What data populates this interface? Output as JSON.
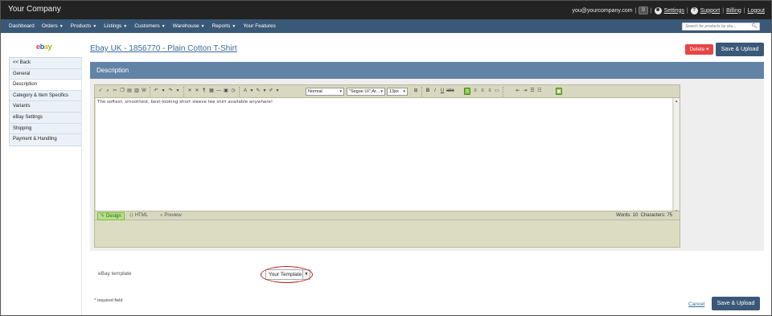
{
  "app": {
    "brand": "Your Company",
    "user_email": "you@yourcompany.com",
    "notification_count": "0",
    "links": {
      "settings": "Settings",
      "support": "Support",
      "billing": "Billing",
      "logout": "Logout"
    }
  },
  "nav": {
    "items": [
      "Dashboard",
      "Orders",
      "Products",
      "Listings",
      "Customers",
      "Warehouse",
      "Reports",
      "Your Features"
    ],
    "caret": "▼",
    "search_placeholder": "Search for products by sku..."
  },
  "sidebar": {
    "logo": {
      "e": "e",
      "b": "b",
      "a": "a",
      "y": "y"
    },
    "items": [
      "<< Back",
      "General",
      "Description",
      "Category & Item Specifics",
      "Variants",
      "eBay Settings",
      "Shipping",
      "Payment & Handling"
    ],
    "active_index": 2
  },
  "header": {
    "title": "Ebay UK - 1856770 - Plain Cotton T-Shirt",
    "delete_label": "Delete ▾",
    "save_label": "Save & Upload"
  },
  "panel": {
    "title": "Description"
  },
  "editor": {
    "format_select": "Normal",
    "font_select": "\"Segoe UI\",Ar...",
    "size_select": "13px",
    "content": "The softest, smoothest, best-looking short sleeve tee shirt available anywhere!",
    "modes": {
      "design": "Design",
      "html": "HTML",
      "preview": "Preview"
    },
    "words": "Words: 10",
    "characters": "Characters: 75"
  },
  "template": {
    "label": "eBay template",
    "value": "Your Template"
  },
  "footer": {
    "required_note": "* required field",
    "cancel_label": "Cancel",
    "save_label": "Save & Upload"
  },
  "colors": {
    "topbar": "#232323",
    "navbar": "#3a5877",
    "panel_header": "#6183a6",
    "delete": "#e84545",
    "save": "#3a5877",
    "highlight_ring": "#bb2222"
  }
}
